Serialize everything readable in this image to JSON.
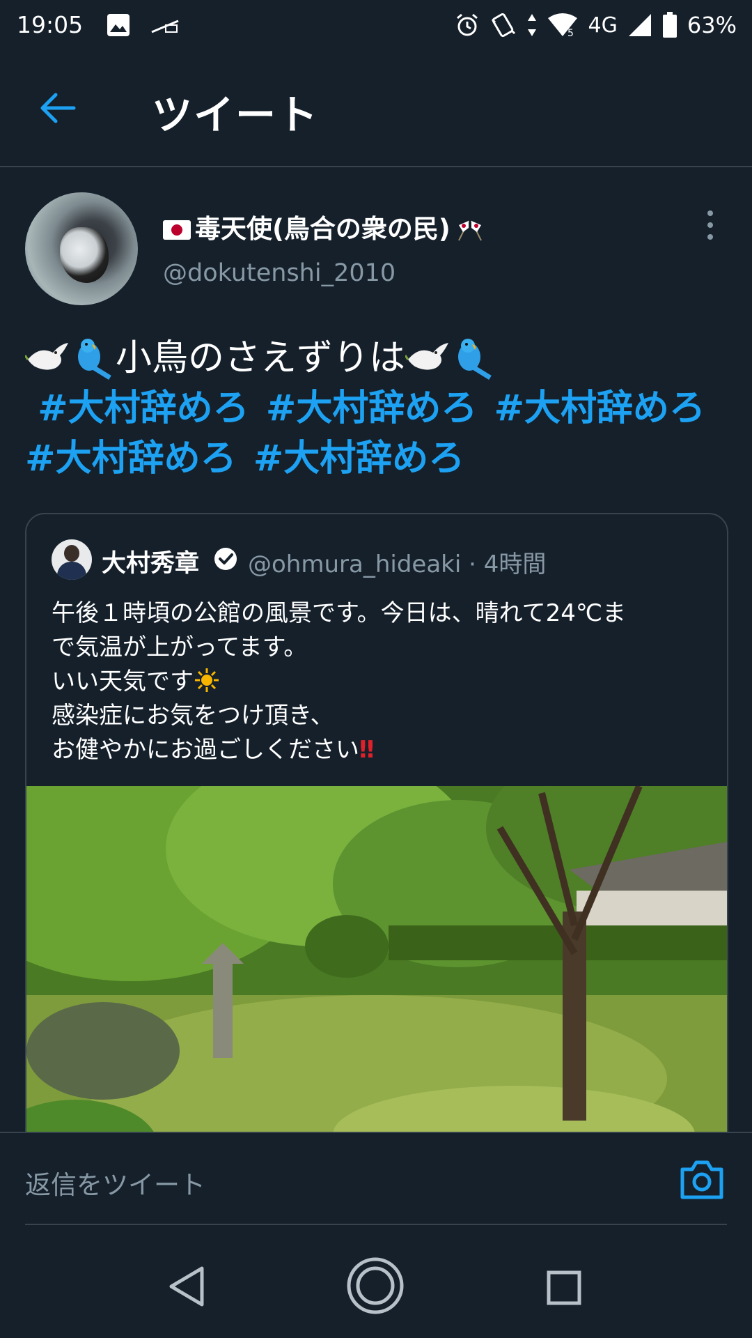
{
  "status_bar": {
    "time": "19:05",
    "network": "4G",
    "battery_percent": "63%",
    "icons": [
      "image-icon",
      "cast-icon",
      "alarm-icon",
      "vibrate-icon",
      "data-arrows-icon",
      "wifi-icon",
      "signal-icon",
      "battery-icon"
    ]
  },
  "header": {
    "title": "ツイート",
    "back_icon": "arrow-left-icon"
  },
  "tweet": {
    "display_name": "毒天使(鳥合の衆の民)",
    "handle": "@dokutenshi_2010",
    "text_line1": "小鳥のさえずりは",
    "hashtags": [
      "#大村辞めろ",
      "#大村辞めろ",
      "#大村辞めろ",
      "#大村辞めろ",
      "#大村辞めろ"
    ]
  },
  "quoted_tweet": {
    "display_name": "大村秀章",
    "handle_time": "@ohmura_hideaki · 4時間",
    "lines": [
      "午後１時頃の公館の風景です。今日は、晴れて24℃ま",
      "で気温が上がってます。",
      "いい天気です",
      "感染症にお気をつけ頂き、",
      "お健やかにお過ごしください"
    ],
    "emphasis": "‼"
  },
  "reply": {
    "placeholder": "返信をツイート"
  },
  "colors": {
    "background": "#15202b",
    "accent": "#1da1f2",
    "secondary_text": "#8899a6",
    "divider": "#38444d"
  }
}
